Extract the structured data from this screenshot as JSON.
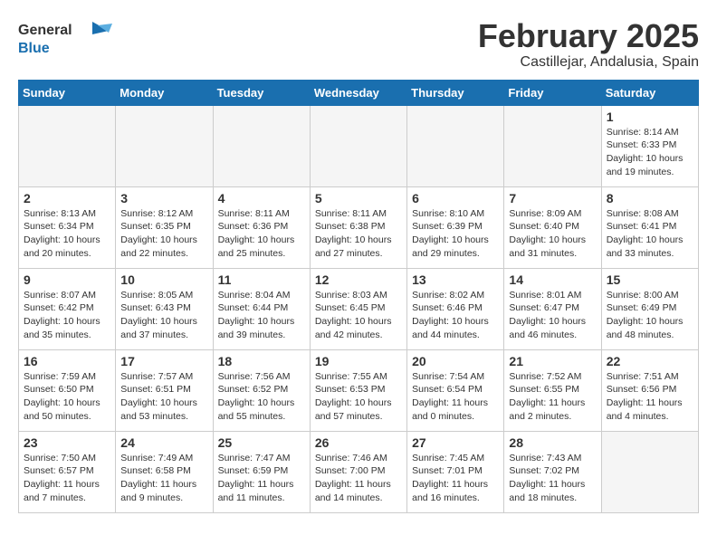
{
  "header": {
    "logo_general": "General",
    "logo_blue": "Blue",
    "month_title": "February 2025",
    "location": "Castillejar, Andalusia, Spain"
  },
  "weekdays": [
    "Sunday",
    "Monday",
    "Tuesday",
    "Wednesday",
    "Thursday",
    "Friday",
    "Saturday"
  ],
  "weeks": [
    [
      {
        "day": "",
        "info": ""
      },
      {
        "day": "",
        "info": ""
      },
      {
        "day": "",
        "info": ""
      },
      {
        "day": "",
        "info": ""
      },
      {
        "day": "",
        "info": ""
      },
      {
        "day": "",
        "info": ""
      },
      {
        "day": "1",
        "info": "Sunrise: 8:14 AM\nSunset: 6:33 PM\nDaylight: 10 hours and 19 minutes."
      }
    ],
    [
      {
        "day": "2",
        "info": "Sunrise: 8:13 AM\nSunset: 6:34 PM\nDaylight: 10 hours and 20 minutes."
      },
      {
        "day": "3",
        "info": "Sunrise: 8:12 AM\nSunset: 6:35 PM\nDaylight: 10 hours and 22 minutes."
      },
      {
        "day": "4",
        "info": "Sunrise: 8:11 AM\nSunset: 6:36 PM\nDaylight: 10 hours and 25 minutes."
      },
      {
        "day": "5",
        "info": "Sunrise: 8:11 AM\nSunset: 6:38 PM\nDaylight: 10 hours and 27 minutes."
      },
      {
        "day": "6",
        "info": "Sunrise: 8:10 AM\nSunset: 6:39 PM\nDaylight: 10 hours and 29 minutes."
      },
      {
        "day": "7",
        "info": "Sunrise: 8:09 AM\nSunset: 6:40 PM\nDaylight: 10 hours and 31 minutes."
      },
      {
        "day": "8",
        "info": "Sunrise: 8:08 AM\nSunset: 6:41 PM\nDaylight: 10 hours and 33 minutes."
      }
    ],
    [
      {
        "day": "9",
        "info": "Sunrise: 8:07 AM\nSunset: 6:42 PM\nDaylight: 10 hours and 35 minutes."
      },
      {
        "day": "10",
        "info": "Sunrise: 8:05 AM\nSunset: 6:43 PM\nDaylight: 10 hours and 37 minutes."
      },
      {
        "day": "11",
        "info": "Sunrise: 8:04 AM\nSunset: 6:44 PM\nDaylight: 10 hours and 39 minutes."
      },
      {
        "day": "12",
        "info": "Sunrise: 8:03 AM\nSunset: 6:45 PM\nDaylight: 10 hours and 42 minutes."
      },
      {
        "day": "13",
        "info": "Sunrise: 8:02 AM\nSunset: 6:46 PM\nDaylight: 10 hours and 44 minutes."
      },
      {
        "day": "14",
        "info": "Sunrise: 8:01 AM\nSunset: 6:47 PM\nDaylight: 10 hours and 46 minutes."
      },
      {
        "day": "15",
        "info": "Sunrise: 8:00 AM\nSunset: 6:49 PM\nDaylight: 10 hours and 48 minutes."
      }
    ],
    [
      {
        "day": "16",
        "info": "Sunrise: 7:59 AM\nSunset: 6:50 PM\nDaylight: 10 hours and 50 minutes."
      },
      {
        "day": "17",
        "info": "Sunrise: 7:57 AM\nSunset: 6:51 PM\nDaylight: 10 hours and 53 minutes."
      },
      {
        "day": "18",
        "info": "Sunrise: 7:56 AM\nSunset: 6:52 PM\nDaylight: 10 hours and 55 minutes."
      },
      {
        "day": "19",
        "info": "Sunrise: 7:55 AM\nSunset: 6:53 PM\nDaylight: 10 hours and 57 minutes."
      },
      {
        "day": "20",
        "info": "Sunrise: 7:54 AM\nSunset: 6:54 PM\nDaylight: 11 hours and 0 minutes."
      },
      {
        "day": "21",
        "info": "Sunrise: 7:52 AM\nSunset: 6:55 PM\nDaylight: 11 hours and 2 minutes."
      },
      {
        "day": "22",
        "info": "Sunrise: 7:51 AM\nSunset: 6:56 PM\nDaylight: 11 hours and 4 minutes."
      }
    ],
    [
      {
        "day": "23",
        "info": "Sunrise: 7:50 AM\nSunset: 6:57 PM\nDaylight: 11 hours and 7 minutes."
      },
      {
        "day": "24",
        "info": "Sunrise: 7:49 AM\nSunset: 6:58 PM\nDaylight: 11 hours and 9 minutes."
      },
      {
        "day": "25",
        "info": "Sunrise: 7:47 AM\nSunset: 6:59 PM\nDaylight: 11 hours and 11 minutes."
      },
      {
        "day": "26",
        "info": "Sunrise: 7:46 AM\nSunset: 7:00 PM\nDaylight: 11 hours and 14 minutes."
      },
      {
        "day": "27",
        "info": "Sunrise: 7:45 AM\nSunset: 7:01 PM\nDaylight: 11 hours and 16 minutes."
      },
      {
        "day": "28",
        "info": "Sunrise: 7:43 AM\nSunset: 7:02 PM\nDaylight: 11 hours and 18 minutes."
      },
      {
        "day": "",
        "info": ""
      }
    ]
  ]
}
